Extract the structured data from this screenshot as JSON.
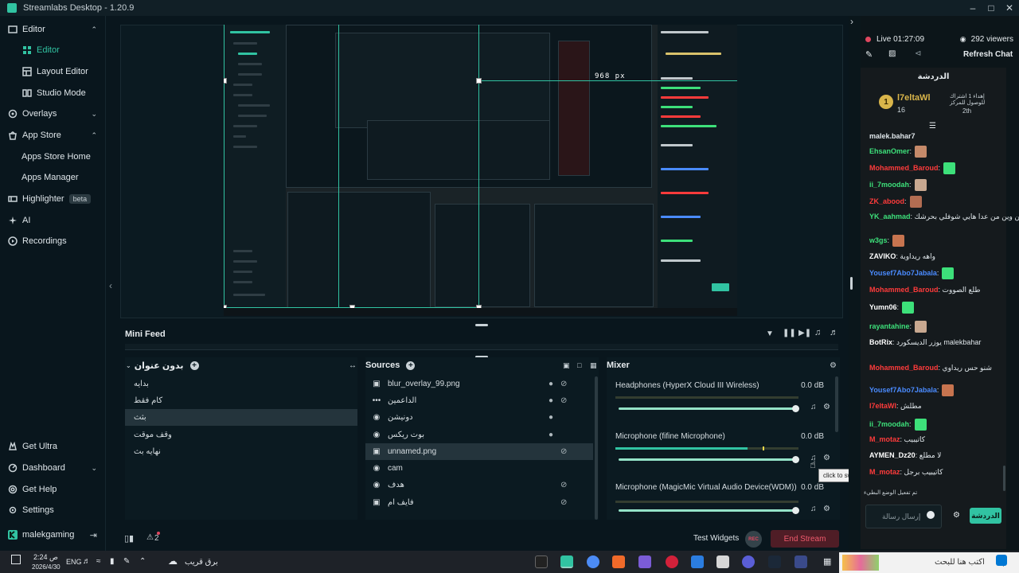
{
  "app": {
    "title": "Streamlabs Desktop - 1.20.9"
  },
  "sidebar": {
    "items": [
      {
        "label": "Editor"
      },
      {
        "label": "Editor"
      },
      {
        "label": "Layout Editor"
      },
      {
        "label": "Studio Mode"
      },
      {
        "label": "Overlays"
      },
      {
        "label": "App Store"
      },
      {
        "label": "Apps Store Home"
      },
      {
        "label": "Apps Manager"
      },
      {
        "label": "Highlighter"
      },
      {
        "label": "AI"
      },
      {
        "label": "Recordings"
      }
    ],
    "beta": "beta",
    "bottom": [
      {
        "label": "Get Ultra"
      },
      {
        "label": "Dashboard"
      },
      {
        "label": "Get Help"
      },
      {
        "label": "Settings"
      }
    ],
    "user": "malekgaming"
  },
  "preview": {
    "px_label": "968 px"
  },
  "minifeed": {
    "title": "Mini Feed"
  },
  "scenes": {
    "title": "بدون عنوان",
    "items": [
      "بدايه",
      "كام فقط",
      "بثث",
      "وقف موقت",
      "نهايه بث"
    ],
    "selected": 2
  },
  "sources": {
    "title": "Sources",
    "items": [
      {
        "name": "blur_overlay_99.png",
        "icon": "image-icon"
      },
      {
        "name": "الداعمين",
        "icon": "dots-icon"
      },
      {
        "name": "دونيشن",
        "icon": "globe-icon"
      },
      {
        "name": "بوت ريكس",
        "icon": "globe-icon"
      },
      {
        "name": "unnamed.png",
        "icon": "image-icon"
      },
      {
        "name": "cam",
        "icon": "camera-icon"
      },
      {
        "name": "هدف",
        "icon": "globe-icon"
      },
      {
        "name": "فايف ام",
        "icon": "gamepad-icon"
      }
    ],
    "selected": 4
  },
  "mixer": {
    "title": "Mixer",
    "channels": [
      {
        "name": "Headphones (HyperX Cloud III Wireless)",
        "db": "0.0 dB",
        "level": 1.0
      },
      {
        "name": "Microphone (fifine Microphone)",
        "db": "0.0 dB",
        "level": 1.0
      },
      {
        "name": "Microphone (MagicMic Virtual Audio Device(WDM))",
        "db": "0.0 dB",
        "level": 1.0
      }
    ],
    "tooltip": "click to switch off"
  },
  "footer": {
    "alerts": "2",
    "test_widgets": "Test Widgets",
    "rec": "REC",
    "end_stream": "End Stream"
  },
  "chat": {
    "live": "Live 01:27:09",
    "viewers": "292 viewers",
    "refresh": "Refresh Chat",
    "header": "الدردشة",
    "leader_name": "l7eltaWl",
    "leader_count": "16",
    "leader_note": "إهداء 1 اشتراك للوصول للمركز",
    "leader_rank": "2th",
    "messages": [
      {
        "user": "malek.bahar7",
        "text": "",
        "color": "#dfe6ea"
      },
      {
        "user": "EhsanOmer",
        "text": ":",
        "color": "#3de07a"
      },
      {
        "user": "Mohammed_Baroud",
        "text": ":",
        "color": "#ff3b3b"
      },
      {
        "user": "ii_7moodah",
        "text": ":",
        "color": "#3de07a"
      },
      {
        "user": "ZK_abood",
        "text": ":",
        "color": "#ff3b3b"
      },
      {
        "user": "YK_aahmad",
        "text": ": من وين من عدا هايي شوفلي بحرشك",
        "color": "#3de07a"
      },
      {
        "user": "w3gs",
        "text": ":",
        "color": "#3de07a"
      },
      {
        "user": "ZAVIKO",
        "text": ": واهه ريداوية",
        "color": "#ffffff"
      },
      {
        "user": "Yousef7Abo7Jabala",
        "text": ":",
        "color": "#4a8bff"
      },
      {
        "user": "Mohammed_Baroud",
        "text": ": طلع الصووت",
        "color": "#ff3b3b"
      },
      {
        "user": "Yumn06",
        "text": ":",
        "color": "#ffffff"
      },
      {
        "user": "rayantahine",
        "text": ":",
        "color": "#3de07a"
      },
      {
        "user": "BotRix",
        "text": ": يوزر الديسكورد malekbahar",
        "color": "#ffffff"
      },
      {
        "user": "Mohammed_Baroud",
        "text": ": شنو حس ريداوي",
        "color": "#ff3b3b"
      },
      {
        "user": "Yousef7Abo7Jabala",
        "text": ":",
        "color": "#4a8bff"
      },
      {
        "user": "l7eltaWl",
        "text": ": مطلش",
        "color": "#ff3b3b"
      },
      {
        "user": "ii_7moodah",
        "text": ":",
        "color": "#3de07a"
      },
      {
        "user": "M_motaz",
        "text": ": كاتيبيب",
        "color": "#ff3b3b"
      },
      {
        "user": "AYMEN_Dz20",
        "text": ": لا مطلع",
        "color": "#ffffff"
      },
      {
        "user": "M_motaz",
        "text": ": كاتيبيب برجل",
        "color": "#ff3b3b"
      }
    ],
    "slow_mode": "تم تفعيل الوضع البطيء",
    "input_placeholder": "إرسال رسالة",
    "send": "الدردشة"
  },
  "taskbar": {
    "time": "2:24 ص",
    "date": "2026/4/30",
    "lang": "ENG",
    "weather": "برق قريب",
    "search": "اكتب هنا للبحث"
  }
}
